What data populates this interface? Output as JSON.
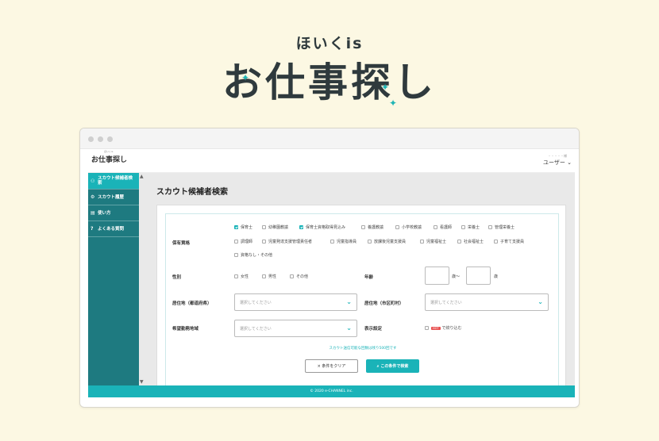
{
  "hero": {
    "subtitle": "ほいくis",
    "title": "お仕事探し"
  },
  "app": {
    "logo_small": "ほいくis",
    "logo": "お仕事探し",
    "user_name_masked": "・・・・・様",
    "user_menu": "ユーザー"
  },
  "sidebar": {
    "items": [
      {
        "label": "スカウト候補者検索",
        "icon": "people-icon"
      },
      {
        "label": "スカウト履歴",
        "icon": "gear-icon"
      },
      {
        "label": "使い方",
        "icon": "document-icon"
      },
      {
        "label": "よくある質問",
        "icon": "question-icon"
      }
    ]
  },
  "main": {
    "title": "スカウト候補者検索"
  },
  "form": {
    "qualification_label": "保有資格",
    "qualifications_row1": [
      {
        "label": "保育士",
        "checked": true
      },
      {
        "label": "幼稚園教諭",
        "checked": false
      },
      {
        "label": "保育士資格取得見込み",
        "checked": true
      },
      {
        "label": "養護教諭",
        "checked": false
      },
      {
        "label": "小学校教諭",
        "checked": false
      },
      {
        "label": "看護師",
        "checked": false
      },
      {
        "label": "栄養士",
        "checked": false
      },
      {
        "label": "管理栄養士",
        "checked": false
      }
    ],
    "qualifications_row2": [
      {
        "label": "調理師",
        "checked": false
      },
      {
        "label": "児童発達支援管理責任者",
        "checked": false
      },
      {
        "label": "児童指導員",
        "checked": false
      },
      {
        "label": "放課後児童支援員",
        "checked": false
      },
      {
        "label": "児童福祉士",
        "checked": false
      },
      {
        "label": "社会福祉士",
        "checked": false
      },
      {
        "label": "子育て支援員",
        "checked": false
      }
    ],
    "qualifications_row3": [
      {
        "label": "資格なし・その他",
        "checked": false
      }
    ],
    "gender_label": "性別",
    "genders": [
      "女性",
      "男性",
      "その他"
    ],
    "age_label": "年齢",
    "age_sep": "歳〜",
    "age_suffix": "歳",
    "prefecture_label": "居住地（都道府県）",
    "city_label": "居住地（市区町村）",
    "area_label": "希望勤務地域",
    "display_label": "表示設定",
    "hot_badge": "HOT",
    "hot_text": "で絞り込む",
    "select_placeholder": "選択してください",
    "notice": "スカウト送信可能な回数は残り500回です",
    "clear_button": "× 条件をクリア",
    "search_button": "この条件で検索"
  },
  "footer": {
    "copyright": "© 2020 e-CHANNEL inc."
  },
  "colors": {
    "teal": "#1ab3b8",
    "sidebar": "#1e7a80",
    "cream": "#fcf8e3"
  }
}
